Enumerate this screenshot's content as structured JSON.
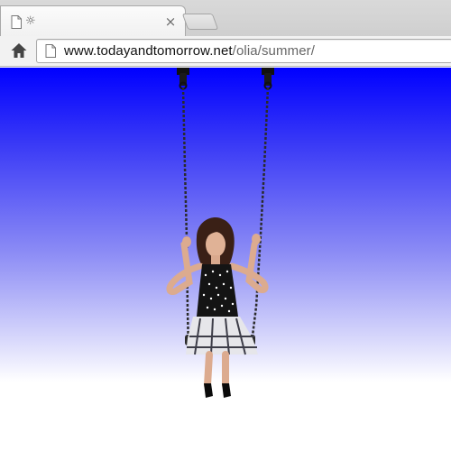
{
  "browser": {
    "tab": {
      "title": "☼",
      "close_label": "×"
    },
    "toolbar": {
      "url_host": "www.todayandtomorrow.net",
      "url_path": "/olia/summer/"
    }
  },
  "page": {
    "background_top_color": "#0000ff",
    "background_bottom_color": "#ffffff"
  },
  "icons": {
    "tab_favicon": "page-icon",
    "home": "home-icon",
    "omnibox_page": "page-icon"
  }
}
